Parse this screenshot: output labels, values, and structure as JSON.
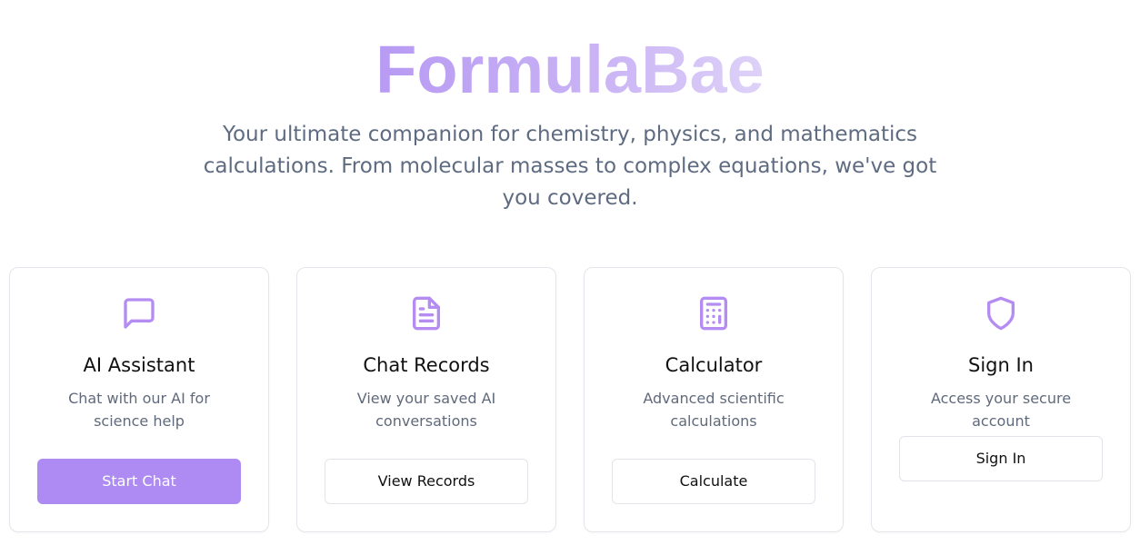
{
  "hero": {
    "title": "FormulaBae",
    "subtitle": "Your ultimate companion for chemistry, physics, and mathematics calculations. From molecular masses to complex equations, we've got you covered."
  },
  "colors": {
    "accent": "#ad8bf3",
    "icon": "#b48cf2",
    "title_gradient_start": "#b79af4",
    "title_gradient_end": "#ded2f8",
    "subtitle_text": "#5e6b80"
  },
  "cards": [
    {
      "icon": "message-square-icon",
      "title": "AI Assistant",
      "description": "Chat with our AI for science help",
      "button_label": "Start Chat",
      "button_style": "primary"
    },
    {
      "icon": "file-text-icon",
      "title": "Chat Records",
      "description": "View your saved AI conversations",
      "button_label": "View Records",
      "button_style": "outline"
    },
    {
      "icon": "calculator-icon",
      "title": "Calculator",
      "description": "Advanced scientific calculations",
      "button_label": "Calculate",
      "button_style": "outline"
    },
    {
      "icon": "shield-icon",
      "title": "Sign In",
      "description": "Access your secure account",
      "button_label": "Sign In",
      "button_style": "outline"
    }
  ]
}
